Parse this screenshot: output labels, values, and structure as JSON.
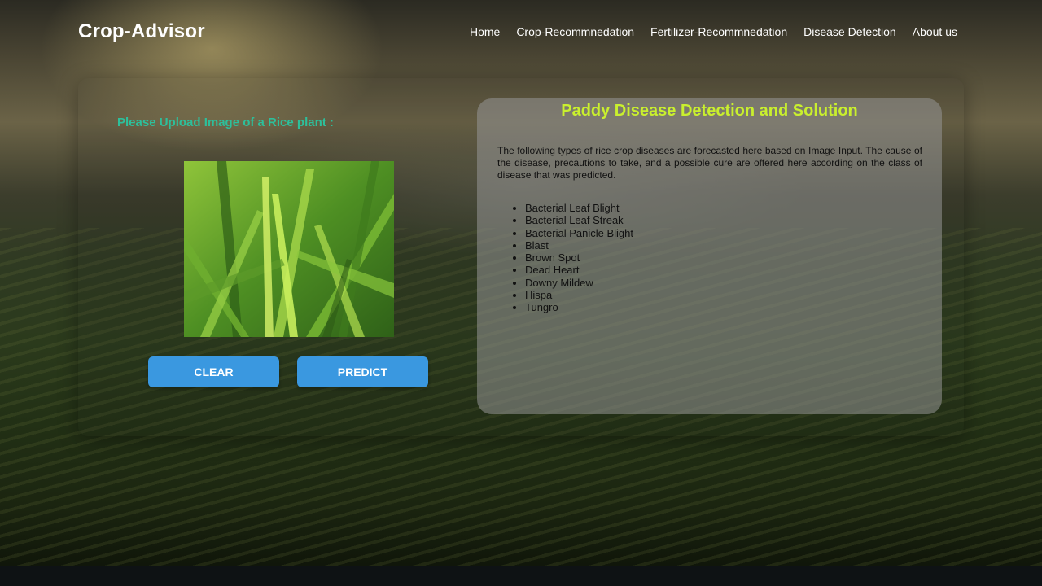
{
  "header": {
    "brand": "Crop-Advisor",
    "nav": [
      {
        "label": "Home"
      },
      {
        "label": "Crop-Recommnedation"
      },
      {
        "label": "Fertilizer-Recommnedation"
      },
      {
        "label": "Disease Detection"
      },
      {
        "label": "About us"
      }
    ]
  },
  "upload": {
    "label": "Please Upload Image of a Rice plant :",
    "image_icon": "rice-plant-photo"
  },
  "buttons": {
    "clear_label": "CLEAR",
    "predict_label": "PREDICT"
  },
  "info": {
    "title": "Paddy Disease Detection and Solution",
    "description": "The following types of rice crop diseases are forecasted here based on Image Input. The cause of the disease, precautions to take, and a possible cure are offered here according on the class of disease that was predicted.",
    "diseases": [
      "Bacterial Leaf Blight",
      "Bacterial Leaf Streak",
      "Bacterial Panicle Blight",
      "Blast",
      "Brown Spot",
      "Dead Heart",
      "Downy Mildew",
      "Hispa",
      "Tungro"
    ]
  },
  "colors": {
    "brand_text": "#ffffff",
    "upload_label": "#2dbf9b",
    "title_accent": "#c9ef2e",
    "button": "#3a98e0"
  }
}
